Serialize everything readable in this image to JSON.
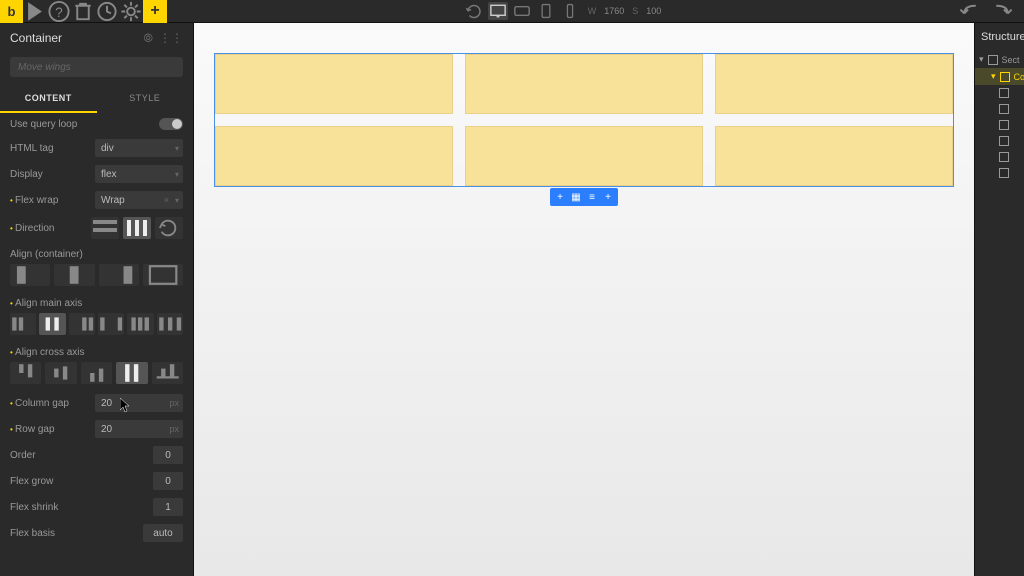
{
  "topbar": {
    "logo": "b",
    "dim_w_label": "W",
    "dim_w": "1760",
    "dim_s_label": "S",
    "dim_s": "100"
  },
  "left": {
    "title": "Container",
    "search_placeholder": "Move wings",
    "tabs": {
      "content": "CONTENT",
      "style": "STYLE"
    },
    "use_query_loop": "Use query loop",
    "html_tag_label": "HTML tag",
    "html_tag_value": "div",
    "display_label": "Display",
    "display_value": "flex",
    "flex_wrap_label": "Flex wrap",
    "flex_wrap_value": "Wrap",
    "direction_label": "Direction",
    "align_container_label": "Align (container)",
    "align_main_label": "Align main axis",
    "align_cross_label": "Align cross axis",
    "column_gap_label": "Column gap",
    "column_gap_value": "20",
    "column_gap_unit": "px",
    "row_gap_label": "Row gap",
    "row_gap_value": "20",
    "row_gap_unit": "px",
    "order_label": "Order",
    "order_value": "0",
    "flex_grow_label": "Flex grow",
    "flex_grow_value": "0",
    "flex_shrink_label": "Flex shrink",
    "flex_shrink_value": "1",
    "flex_basis_label": "Flex basis",
    "flex_basis_value": "auto"
  },
  "right": {
    "title": "Structure",
    "items": [
      "Sect",
      "Co",
      "",
      "",
      "",
      "",
      "",
      ""
    ]
  }
}
